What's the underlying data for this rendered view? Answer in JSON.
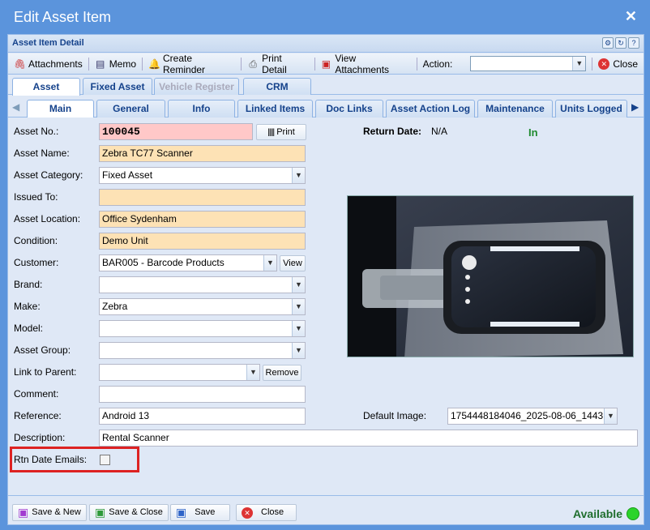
{
  "window": {
    "title": "Edit Asset Item"
  },
  "panel": {
    "title": "Asset Item Detail"
  },
  "toolbar": {
    "attachments": "Attachments",
    "memo": "Memo",
    "create_reminder": "Create Reminder",
    "print_detail": "Print Detail",
    "view_attachments": "View Attachments",
    "action_label": "Action:",
    "action_value": "",
    "close": "Close"
  },
  "tabs_top": [
    {
      "label": "Asset",
      "active": true
    },
    {
      "label": "Fixed Asset",
      "active": false
    },
    {
      "label": "Vehicle Register",
      "active": false,
      "disabled": true
    },
    {
      "label": "CRM",
      "active": false
    }
  ],
  "tabs_sub": [
    {
      "label": "Main",
      "active": true
    },
    {
      "label": "General"
    },
    {
      "label": "Info"
    },
    {
      "label": "Linked Items"
    },
    {
      "label": "Doc Links"
    },
    {
      "label": "Asset Action Log"
    },
    {
      "label": "Maintenance"
    },
    {
      "label": "Units Logged"
    }
  ],
  "form": {
    "asset_no": {
      "label": "Asset No.:",
      "value": "100045"
    },
    "print_btn": "Print",
    "asset_name": {
      "label": "Asset Name:",
      "value": "Zebra TC77 Scanner"
    },
    "asset_category": {
      "label": "Asset Category:",
      "value": "Fixed Asset"
    },
    "issued_to": {
      "label": "Issued To:",
      "value": ""
    },
    "asset_location": {
      "label": "Asset Location:",
      "value": "Office Sydenham"
    },
    "condition": {
      "label": "Condition:",
      "value": "Demo Unit"
    },
    "customer": {
      "label": "Customer:",
      "value": "BAR005 - Barcode Products"
    },
    "view_btn": "View",
    "brand": {
      "label": "Brand:",
      "value": ""
    },
    "make": {
      "label": "Make:",
      "value": "Zebra"
    },
    "model": {
      "label": "Model:",
      "value": ""
    },
    "asset_group": {
      "label": "Asset Group:",
      "value": ""
    },
    "link_to_parent": {
      "label": "Link to Parent:",
      "value": ""
    },
    "remove_btn": "Remove",
    "comment": {
      "label": "Comment:",
      "value": ""
    },
    "reference": {
      "label": "Reference:",
      "value": "Android 13"
    },
    "default_image": {
      "label": "Default Image:",
      "value": "1754448184046_2025-08-06_1443"
    },
    "description": {
      "label": "Description:",
      "value": "Rental Scanner"
    },
    "rtn_date_emails": {
      "label": "Rtn Date Emails:",
      "checked": false
    },
    "return_date": {
      "label": "Return Date:",
      "value": "N/A"
    },
    "status_in": "In"
  },
  "footer": {
    "save_new": "Save & New",
    "save_close": "Save & Close",
    "save": "Save",
    "close": "Close",
    "availability": "Available"
  },
  "colors": {
    "status_in": "#1f8a2e",
    "available_dot": "#2bd42b",
    "highlight": "#dd2222"
  }
}
